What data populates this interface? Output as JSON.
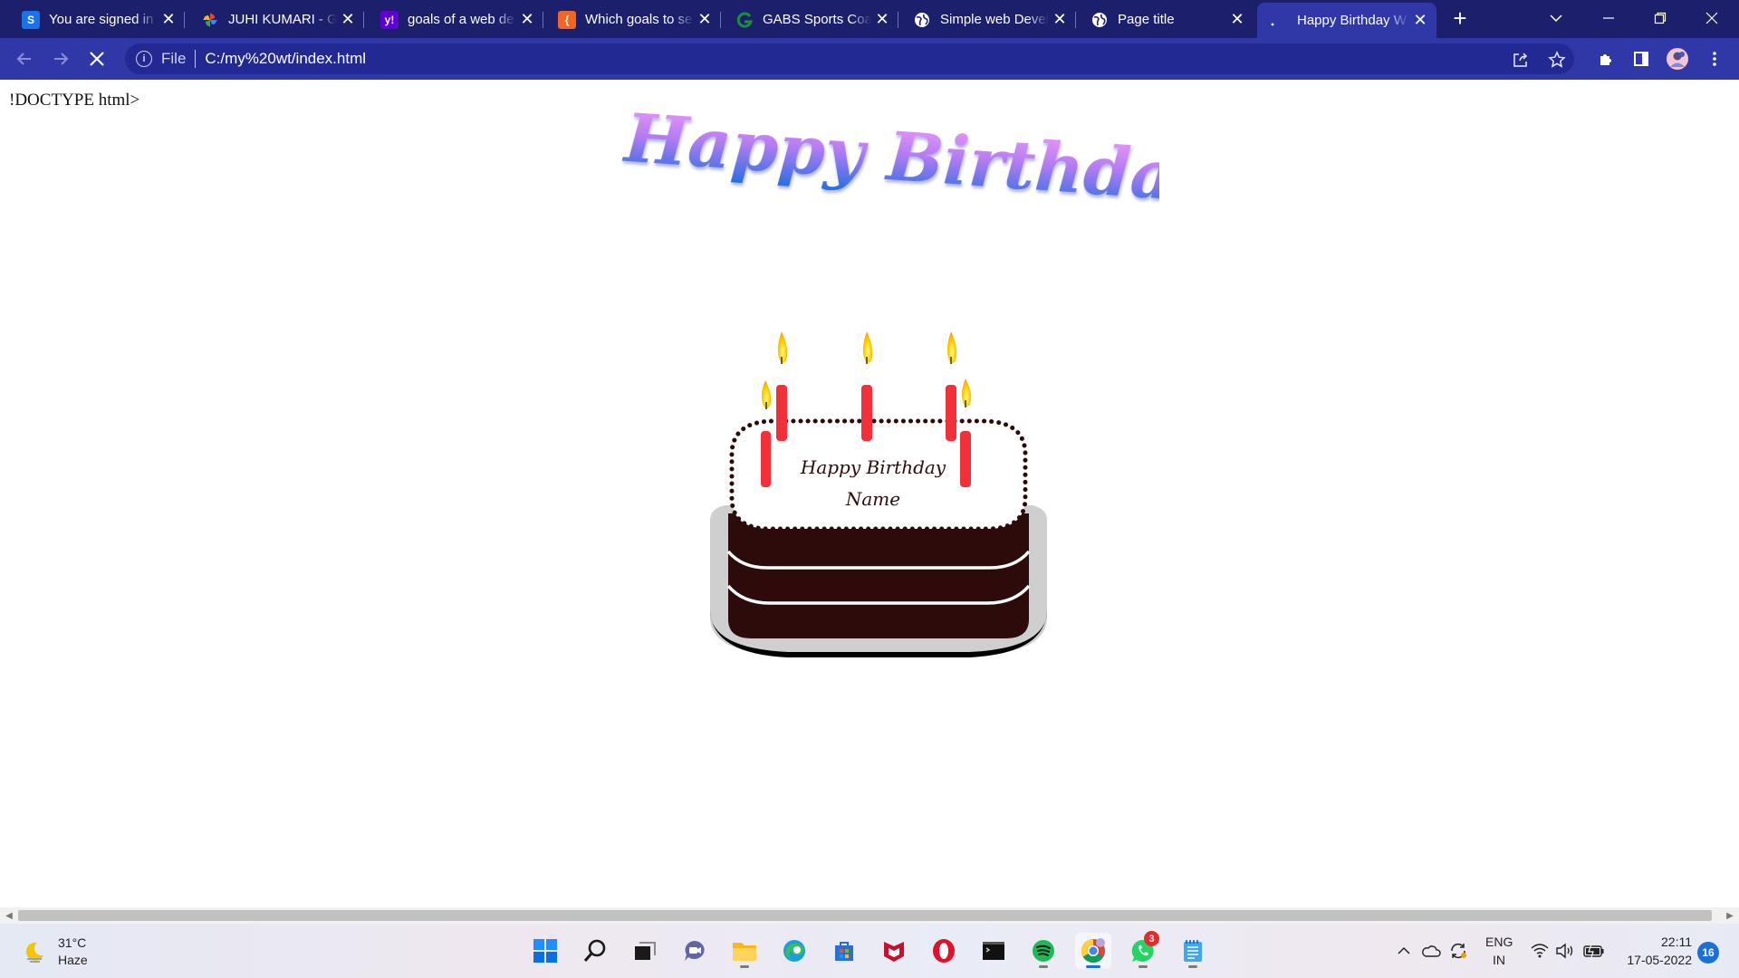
{
  "browser": {
    "tabs": [
      {
        "title": "You are signed in",
        "favicon": "s-letter-icon",
        "color": "#1a73e8",
        "active": false
      },
      {
        "title": "JUHI KUMARI - Go",
        "favicon": "pinwheel-icon",
        "color": "#34a853",
        "active": false
      },
      {
        "title": "goals of a web de",
        "favicon": "yahoo-icon",
        "color": "#6001d2",
        "active": false
      },
      {
        "title": "Which goals to se",
        "favicon": "bracket-icon",
        "color": "#f26522",
        "active": false
      },
      {
        "title": "GABS Sports Coac",
        "favicon": "g-logo-icon",
        "color": "#1e8e3e",
        "active": false
      },
      {
        "title": "Simple web Devel",
        "favicon": "globe-icon",
        "color": "#ffffff",
        "active": false
      },
      {
        "title": "Page title",
        "favicon": "globe-icon",
        "color": "#ffffff",
        "active": false
      },
      {
        "title": "Happy Birthday W",
        "favicon": "loading-icon",
        "color": "#ffffff",
        "active": true
      }
    ],
    "new_tab_label": "+",
    "address": {
      "scheme_label": "File",
      "url": "C:/my%20wt/index.html"
    }
  },
  "page": {
    "doctype_text": "!DOCTYPE html>",
    "headline": "Happy Birthday",
    "cake_text_line1": "Happy Birthday",
    "cake_text_line2": "Name"
  },
  "taskbar": {
    "weather": {
      "temp": "31°C",
      "condition": "Haze"
    },
    "apps": [
      {
        "name": "start",
        "icon": "windows-icon"
      },
      {
        "name": "search",
        "icon": "search-icon"
      },
      {
        "name": "task-view",
        "icon": "task-view-icon"
      },
      {
        "name": "teams-chat",
        "icon": "chat-icon"
      },
      {
        "name": "file-explorer",
        "icon": "folder-icon"
      },
      {
        "name": "edge",
        "icon": "edge-icon"
      },
      {
        "name": "store",
        "icon": "store-icon"
      },
      {
        "name": "mcafee",
        "icon": "mcafee-icon"
      },
      {
        "name": "opera",
        "icon": "opera-icon"
      },
      {
        "name": "terminal",
        "icon": "terminal-icon"
      },
      {
        "name": "spotify",
        "icon": "spotify-icon"
      },
      {
        "name": "chrome",
        "icon": "chrome-icon"
      },
      {
        "name": "whatsapp",
        "icon": "whatsapp-icon",
        "badge": "3"
      },
      {
        "name": "notepad",
        "icon": "notepad-icon"
      }
    ],
    "language": {
      "line1": "ENG",
      "line2": "IN"
    },
    "clock": {
      "time": "22:11",
      "date": "17-05-2022"
    },
    "notification_count": "16"
  }
}
